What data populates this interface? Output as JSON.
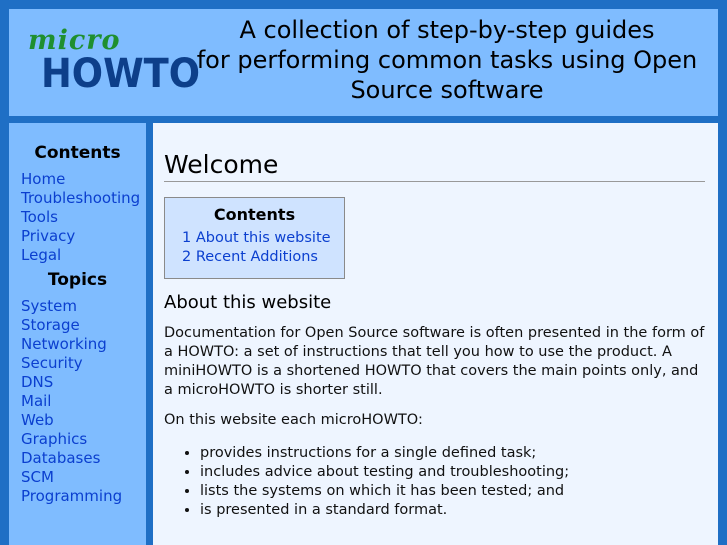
{
  "header": {
    "logo_micro": "micro",
    "logo_howto": "HOWTO",
    "tagline_lines": [
      "A collection of step-by-step guides",
      "for performing common tasks using Open",
      "Source software"
    ]
  },
  "sidebar": {
    "contents_heading": "Contents",
    "contents_links": [
      "Home",
      "Troubleshooting",
      "Tools",
      "Privacy",
      "Legal"
    ],
    "topics_heading": "Topics",
    "topics_links": [
      "System",
      "Storage",
      "Networking",
      "Security",
      "DNS",
      "Mail",
      "Web",
      "Graphics",
      "Databases",
      "SCM",
      "Programming"
    ]
  },
  "main": {
    "title": "Welcome",
    "toc": {
      "title": "Contents",
      "items": [
        "1 About this website",
        "2 Recent Additions"
      ]
    },
    "section_title": "About this website",
    "paragraph1": "Documentation for Open Source software is often presented in the form of a HOWTO: a set of instructions that tell you how to use the product. A miniHOWTO is a shortened HOWTO that covers the main points only, and a microHOWTO is shorter still.",
    "paragraph2": "On this website each microHOWTO:",
    "bullets": [
      "provides instructions for a single defined task;",
      "includes advice about testing and troubleshooting;",
      "lists the systems on which it has been tested; and",
      "is presented in a standard format."
    ]
  },
  "colors": {
    "frame": "#1f6fc5",
    "panel": "#7fbcff",
    "content_bg": "#eef5ff",
    "link": "#0b3fcf",
    "logo_micro": "#1f8f2f",
    "logo_howto": "#0d3f8a"
  }
}
